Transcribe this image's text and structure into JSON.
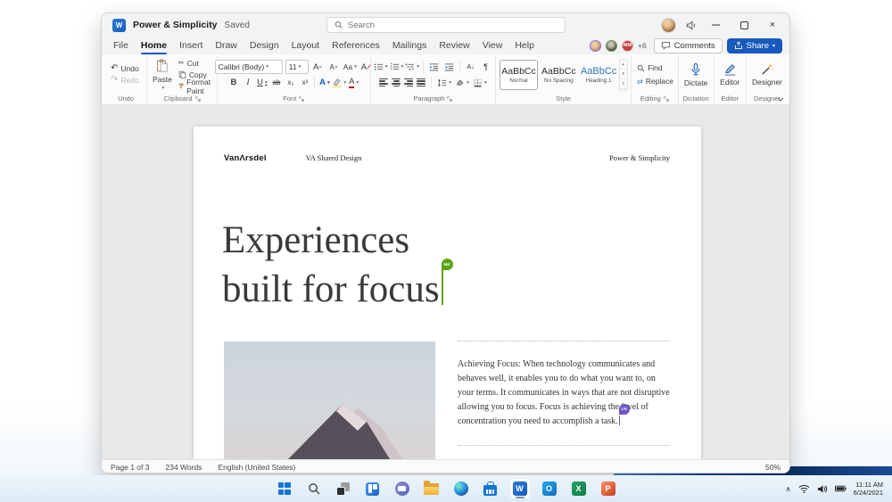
{
  "titlebar": {
    "title": "Power & Simplicity",
    "saved": "Saved",
    "search_placeholder": "Search"
  },
  "tabs": {
    "items": [
      "File",
      "Home",
      "Insert",
      "Draw",
      "Design",
      "Layout",
      "References",
      "Mailings",
      "Review",
      "View",
      "Help"
    ],
    "active": "Home"
  },
  "collab": {
    "overflow": "+6",
    "badge": "MM",
    "comments": "Comments",
    "share": "Share"
  },
  "ribbon": {
    "undo": {
      "undo": "Undo",
      "redo": "Redo",
      "label": "Undo"
    },
    "clipboard": {
      "paste": "Paste",
      "cut": "Cut",
      "copy": "Copy",
      "format_painter": "Format Paint",
      "label": "Clipboard"
    },
    "font": {
      "family": "Calibri (Body)",
      "size": "11",
      "label": "Font"
    },
    "paragraph": {
      "label": "Paragraph"
    },
    "style": {
      "label": "Style",
      "cards": [
        {
          "preview": "AaBbCc",
          "name": "Normal"
        },
        {
          "preview": "AaBbCc",
          "name": "No Spacing"
        },
        {
          "preview": "AaBbCc",
          "name": "Heading 1"
        }
      ]
    },
    "editing": {
      "find": "Find",
      "replace": "Replace",
      "label": "Editing"
    },
    "dictation": {
      "dictate": "Dictate",
      "label": "Dictation"
    },
    "editor": {
      "editor": "Editor",
      "label": "Editor"
    },
    "designer": {
      "designer": "Designer",
      "label": "Designer"
    }
  },
  "document": {
    "header": {
      "logo": "VanΛrsdel",
      "center": "VA Shared Design",
      "right": "Power & Simplicity"
    },
    "heading": {
      "line1": "Experiences",
      "line2": "built for focus"
    },
    "cursors": {
      "green": "MK",
      "purple": "LN"
    },
    "body": "Achieving Focus: When technology communicates and behaves well, it enables you to do what you want to, on your terms. It communicates in ways that are not disruptive allowing you to focus. Focus is achieving the level of concentration you need to accomplish a task."
  },
  "statusbar": {
    "page": "Page 1 of 3",
    "words": "234 Words",
    "language": "English (United States)",
    "zoom": "50%"
  },
  "taskbar": {
    "time": "11:11 AM",
    "date": "6/24/2021"
  },
  "glyphs": {
    "undo": "↶",
    "redo": "↷",
    "cut": "✂",
    "pilcrow": "¶",
    "bold": "B",
    "italic": "I",
    "underline": "U",
    "strikethrough": "ab",
    "subscript": "x₂",
    "superscript": "x²",
    "change_case": "Aa",
    "grow_font": "A",
    "shrink_font": "A",
    "clear_formatting": "A",
    "text_effects": "A",
    "font_color": "A",
    "replace_arrows": "⇄",
    "sort_az": "A↓",
    "close": "×",
    "tray_chevron": "∧",
    "word_letter": "W",
    "outlook_letter": "O",
    "excel_letter": "X",
    "powerpoint_letter": "P"
  },
  "colors": {
    "accent": "#185abd",
    "heading_style_blue": "#2e74b5",
    "cursor_green": "#5aa313",
    "cursor_purple": "#7059c6"
  }
}
